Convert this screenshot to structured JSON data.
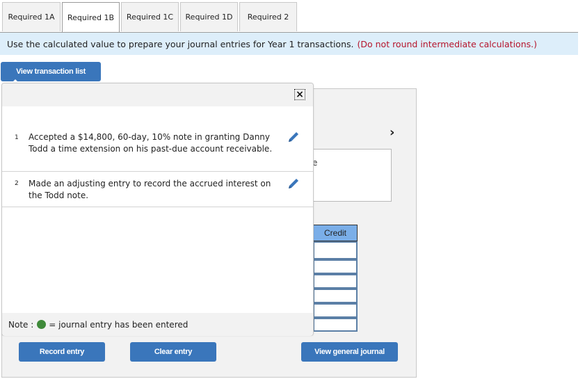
{
  "tabs": [
    {
      "label": "Required 1A",
      "active": false
    },
    {
      "label": "Required 1B",
      "active": true
    },
    {
      "label": "Required 1C",
      "active": false
    },
    {
      "label": "Required 1D",
      "active": false
    },
    {
      "label": "Required 2",
      "active": false
    }
  ],
  "instruction": {
    "text": "Use the calculated value to prepare your journal entries for Year 1 transactions.",
    "note": "(Do not round intermediate calculations.)"
  },
  "buttons": {
    "view_transaction_list": "View transaction list",
    "record_entry": "Record entry",
    "clear_entry": "Clear entry",
    "view_general_journal": "View general journal"
  },
  "popup": {
    "close_label": "×",
    "transactions": [
      {
        "number": "1",
        "text": "Accepted a $14,800, 60-day, 10% note in granting Danny Todd a time extension on his past-due account receivable."
      },
      {
        "number": "2",
        "text": "Made an adjusting entry to record the accrued interest on the Todd note."
      }
    ],
    "note": {
      "prefix": "Note :",
      "suffix": "= journal entry has been entered",
      "dot_color": "#3f8a3a"
    }
  },
  "journal": {
    "next_icon": "›",
    "description_fragment": "e",
    "credit_header": "Credit",
    "credit_values": [
      "",
      "",
      "",
      "",
      "",
      ""
    ]
  },
  "colors": {
    "accent": "#3a76bb",
    "instruction_bg": "#ddeefa",
    "instruction_note": "#b5152b",
    "credit_header_bg": "#7aaee8"
  }
}
